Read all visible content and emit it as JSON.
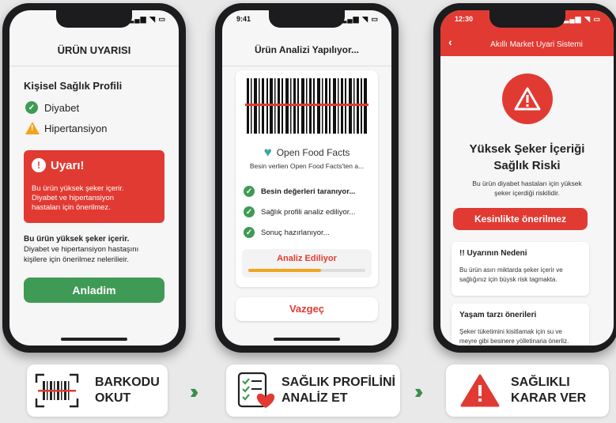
{
  "phone1": {
    "header": "ÜRÜN UYARISI",
    "profile_title": "Kişisel Sağlık Profili",
    "conditions": [
      "Diyabet",
      "Hipertansiyon"
    ],
    "warning_title": "Uyarı!",
    "warning_line1": "Bu ürün yüksek şeker içerir.",
    "warning_line2": "Diyabet ve hipertansiyon",
    "warning_line3": "hastaları için önerilmez.",
    "info_line1": "Bu ürün yüksek şeker içerir.",
    "info_line2": "Diyabet ve hipertansiyon hastaşını",
    "info_line3": "kişilere için önerilmez nelerilieir.",
    "button": "Anladim"
  },
  "phone2": {
    "time": "9:41",
    "header": "Ürün Analizi Yapılıyor...",
    "source_name": "Open Food Facts",
    "source_sub": "Besin verlien Open Food Facts'ten a...",
    "steps": [
      "Besin değerleri taranıyor...",
      "Sağlık profili analiz ediliyor...",
      "Sonuç hazırlanıyor..."
    ],
    "progress_label": "Analiz Ediliyor",
    "progress": 0.62,
    "cancel": "Vazgeç"
  },
  "phone3": {
    "time": "12:30",
    "header": "Akıllı Market Uyari Sistemi",
    "risk_title1": "Yüksek Şeker İçeriği",
    "risk_title2": "Sağlık Riski",
    "risk_sub1": "Bu ürün diyabet hastaları için yüksek",
    "risk_sub2": "şeker içerdiği riskilidir.",
    "recommend": "Kesinlikte önerilmez",
    "reason_title": "!! Uyarının Nedeni",
    "reason_line1": "Bu ürün asırı miktarda şeker içerir ve",
    "reason_line2": "sağlığınız için büysk risk tagmakta.",
    "life_title": "Yaşam tarzı önerileri",
    "life_line1": "Şeker tüketimini kisitlamak için su ve",
    "life_line2": "meyre gibi besinere yölletinaria önerliz."
  },
  "steps_bar": {
    "step1": [
      "BARKODU",
      "OKUT"
    ],
    "step2": [
      "SAĞLIK PROFİLİNİ",
      "ANALİZ ET"
    ],
    "step3": [
      "SAĞLIKLI",
      "KARAR VER"
    ]
  },
  "colors": {
    "green": "#3f9a56",
    "red": "#e13a32",
    "orange": "#f0a51f",
    "teal": "#3aa6a0"
  }
}
